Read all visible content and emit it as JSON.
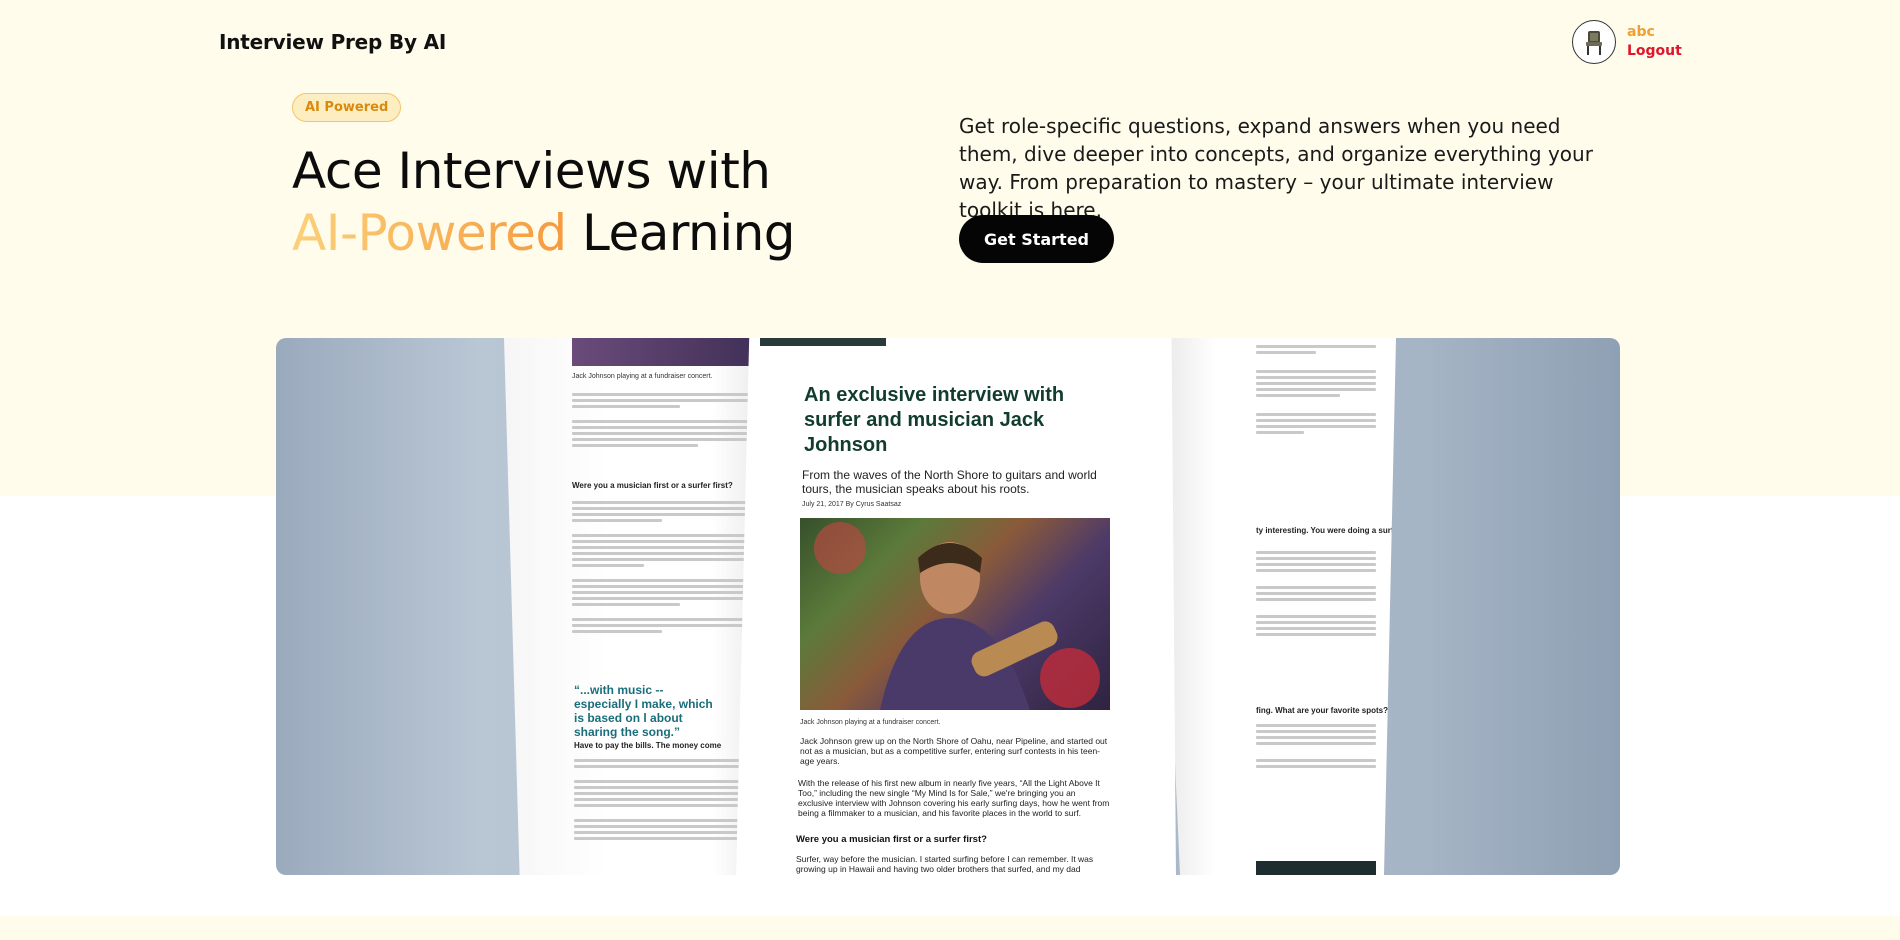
{
  "header": {
    "brand": "Interview Prep By AI",
    "user": {
      "name": "abc",
      "logout_label": "Logout"
    }
  },
  "hero": {
    "badge": "AI Powered",
    "title_line1": "Ace Interviews with",
    "title_accent": "AI-Powered",
    "title_rest": "Learning",
    "description": "Get role-specific questions, expand answers when you need them, dive deeper into concepts, and organize everything your way. From preparation to mastery – your ultimate interview toolkit is here.",
    "cta_label": "Get Started"
  },
  "preview_image": {
    "center_page": {
      "title": "An exclusive interview with surfer and musician Jack Johnson",
      "subtitle": "From the waves of the North Shore to guitars and world tours, the musician speaks about his roots.",
      "byline": "July 21, 2017 By Cyrus Saatsaz",
      "caption": "Jack Johnson playing at a fundraiser concert.",
      "para1": "Jack Johnson grew up on the North Shore of Oahu, near Pipeline, and started out not as a musician, but as a competitive surfer, entering surf contests in his teen-age years.",
      "para2": "With the release of his first new album in nearly five years, “All the Light Above It Too,” including the new single “My Mind Is for Sale,” we're bringing you an exclusive interview with Johnson covering his early surfing days, how he went from being a filmmaker to a musician, and his favorite places in the world to surf.",
      "question": "Were you a musician first or a surfer first?",
      "para3": "Surfer, way before the musician. I started surfing before I can remember. It was growing up in Hawaii and having two older brothers that surfed, and my dad"
    },
    "left_page": {
      "caption": "Jack Johnson playing at a fundraiser concert.",
      "question": "Were you a musician first or a surfer first?",
      "pull_quote": "“...with music -- especially I make, which is based on l about sharing the song.”",
      "subhead": "Have to pay the bills. The money come"
    },
    "right_page": {
      "question1": "ty interesting. You were doing a surf film,",
      "question2": "fing. What are your favorite spots?"
    }
  },
  "colors": {
    "background_cream": "#fffcec",
    "accent_orange": "#f59a3e",
    "logout_red": "#e0142a",
    "cta_black": "#050505"
  }
}
